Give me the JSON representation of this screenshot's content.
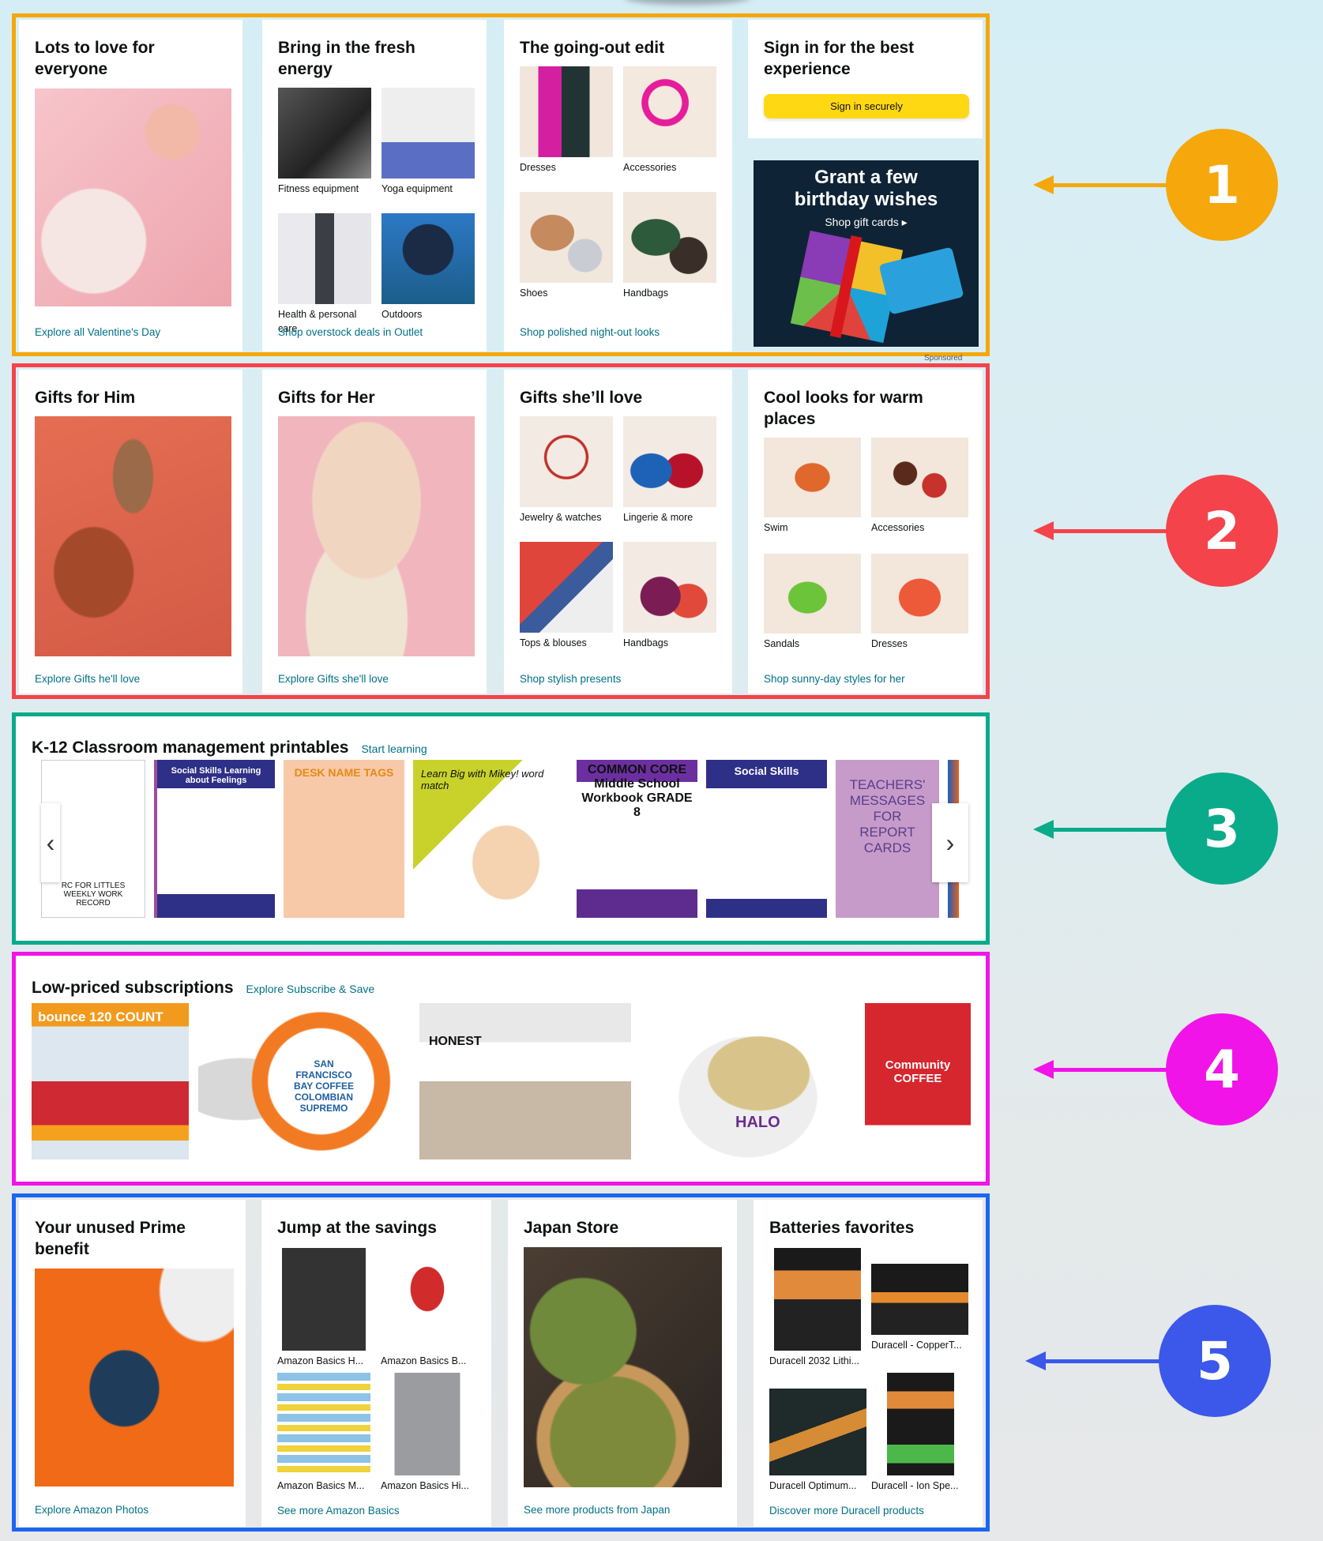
{
  "colors": {
    "section1": "#f5a70b",
    "section2": "#f4434b",
    "section3": "#0aab8a",
    "section4": "#f014e8",
    "section5": "#1c66f1",
    "link": "#007185",
    "signin_button": "#ffd814"
  },
  "markers": [
    "1",
    "2",
    "3",
    "4",
    "5"
  ],
  "section1": {
    "cards": [
      {
        "title": "Lots to love for everyone",
        "link": "Explore all Valentine's Day"
      },
      {
        "title": "Bring in the fresh energy",
        "items": [
          "Fitness equipment",
          "Yoga equipment",
          "Health & personal care",
          "Outdoors"
        ],
        "link": "Shop overstock deals in Outlet"
      },
      {
        "title": "The going-out edit",
        "items": [
          "Dresses",
          "Accessories",
          "Shoes",
          "Handbags"
        ],
        "link": "Shop polished night-out looks"
      },
      {
        "title": "Sign in for the best experience",
        "button": "Sign in securely"
      }
    ],
    "ad": {
      "line1": "Grant a few",
      "line2": "birthday wishes",
      "cta": "Shop gift cards ▸",
      "sponsored": "Sponsored"
    }
  },
  "section2": {
    "cards": [
      {
        "title": "Gifts for Him",
        "link": "Explore Gifts he'll love"
      },
      {
        "title": "Gifts for Her",
        "link": "Explore Gifts she'll love"
      },
      {
        "title": "Gifts she’ll love",
        "items": [
          "Jewelry & watches",
          "Lingerie & more",
          "Tops & blouses",
          "Handbags"
        ],
        "link": "Shop stylish presents"
      },
      {
        "title": "Cool looks for warm places",
        "items": [
          "Swim",
          "Accessories",
          "Sandals",
          "Dresses"
        ],
        "link": "Shop sunny-day styles for her"
      }
    ]
  },
  "section3": {
    "title": "K-12 Classroom management printables",
    "link": "Start learning",
    "items": [
      "RC FOR LITTLES WEEKLY WORK RECORD",
      "Social Skills Learning about Feelings",
      "DESK NAME TAGS",
      "Learn Big with Mikey! word match",
      "COMMON CORE Middle School Workbook GRADE 8",
      "Social Skills",
      "TEACHERS' MESSAGES FOR REPORT CARDS"
    ],
    "prev_icon": "chevron-left-icon",
    "next_icon": "chevron-right-icon"
  },
  "section4": {
    "title": "Low-priced subscriptions",
    "link": "Explore Subscribe & Save",
    "items": [
      "bounce 120 COUNT",
      "SAN FRANCISCO BAY COFFEE COLOMBIAN SUPREMO",
      "HONEST",
      "HALO",
      "Community COFFEE"
    ]
  },
  "section5": {
    "cards": [
      {
        "title": "Your unused Prime benefit",
        "link": "Explore Amazon Photos"
      },
      {
        "title": "Jump at the savings",
        "items": [
          "Amazon Basics H...",
          "Amazon Basics B...",
          "Amazon Basics M...",
          "Amazon Basics Hi..."
        ],
        "link": "See more Amazon Basics"
      },
      {
        "title": "Japan Store",
        "link": "See more products from Japan"
      },
      {
        "title": "Batteries favorites",
        "items": [
          "Duracell 2032 Lithi...",
          "Duracell - CopperT...",
          "Duracell Optimum...",
          "Duracell - Ion Spe..."
        ],
        "link": "Discover more Duracell products"
      }
    ]
  }
}
